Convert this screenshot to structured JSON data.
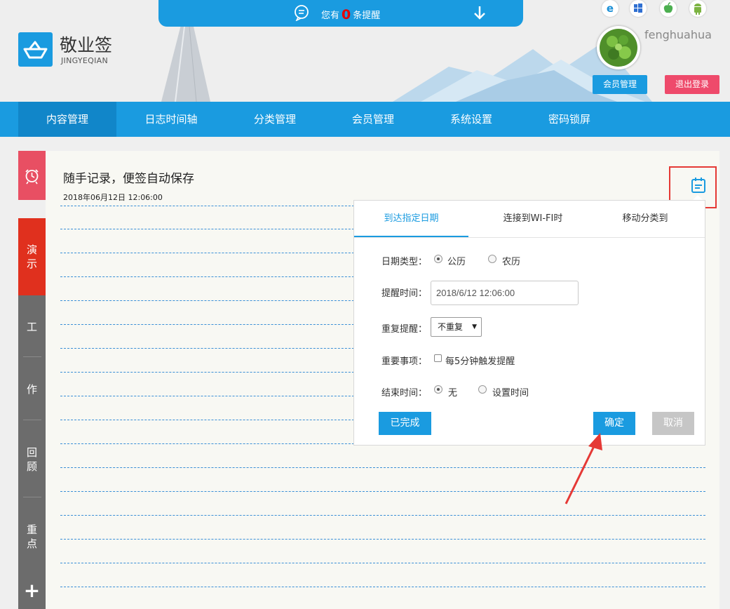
{
  "notice": {
    "prefix": "您有",
    "count": "0",
    "suffix": "条提醒"
  },
  "brand": {
    "name": "敬业签",
    "sub": "JINGYEQIAN"
  },
  "user": {
    "name": "fenghuahua",
    "member_btn": "会员管理",
    "logout_btn": "退出登录"
  },
  "os_icons": [
    "ie-icon",
    "windows-icon",
    "apple-icon",
    "android-icon"
  ],
  "nav": [
    "内容管理",
    "日志时间轴",
    "分类管理",
    "会员管理",
    "系统设置",
    "密码锁屏"
  ],
  "sidebar": {
    "demo": [
      "演",
      "示"
    ],
    "work": "工",
    "make": "作",
    "review": [
      "回",
      "顾"
    ],
    "key": [
      "重",
      "点"
    ],
    "add": "+"
  },
  "note": {
    "title": "随手记录，便签自动保存",
    "date": "2018年06月12日 12:06:00"
  },
  "popup": {
    "tabs": [
      "到达指定日期",
      "连接到WI-FI时",
      "移动分类到"
    ],
    "date_type_label": "日期类型：",
    "solar": "公历",
    "lunar": "农历",
    "remind_time_label": "提醒时间：",
    "remind_time_value": "2018/6/12 12:06:00",
    "repeat_label": "重复提醒：",
    "repeat_value": "不重复",
    "important_label": "重要事项：",
    "important_option": "每5分钟触发提醒",
    "end_time_label": "结束时间：",
    "end_none": "无",
    "end_set": "设置时间",
    "done_btn": "已完成",
    "ok_btn": "确定",
    "cancel_btn": "取消"
  },
  "colors": {
    "primary": "#1a9be0",
    "danger": "#ee4a6b",
    "demo": "#e0301e",
    "gray": "#6c6c6c"
  }
}
